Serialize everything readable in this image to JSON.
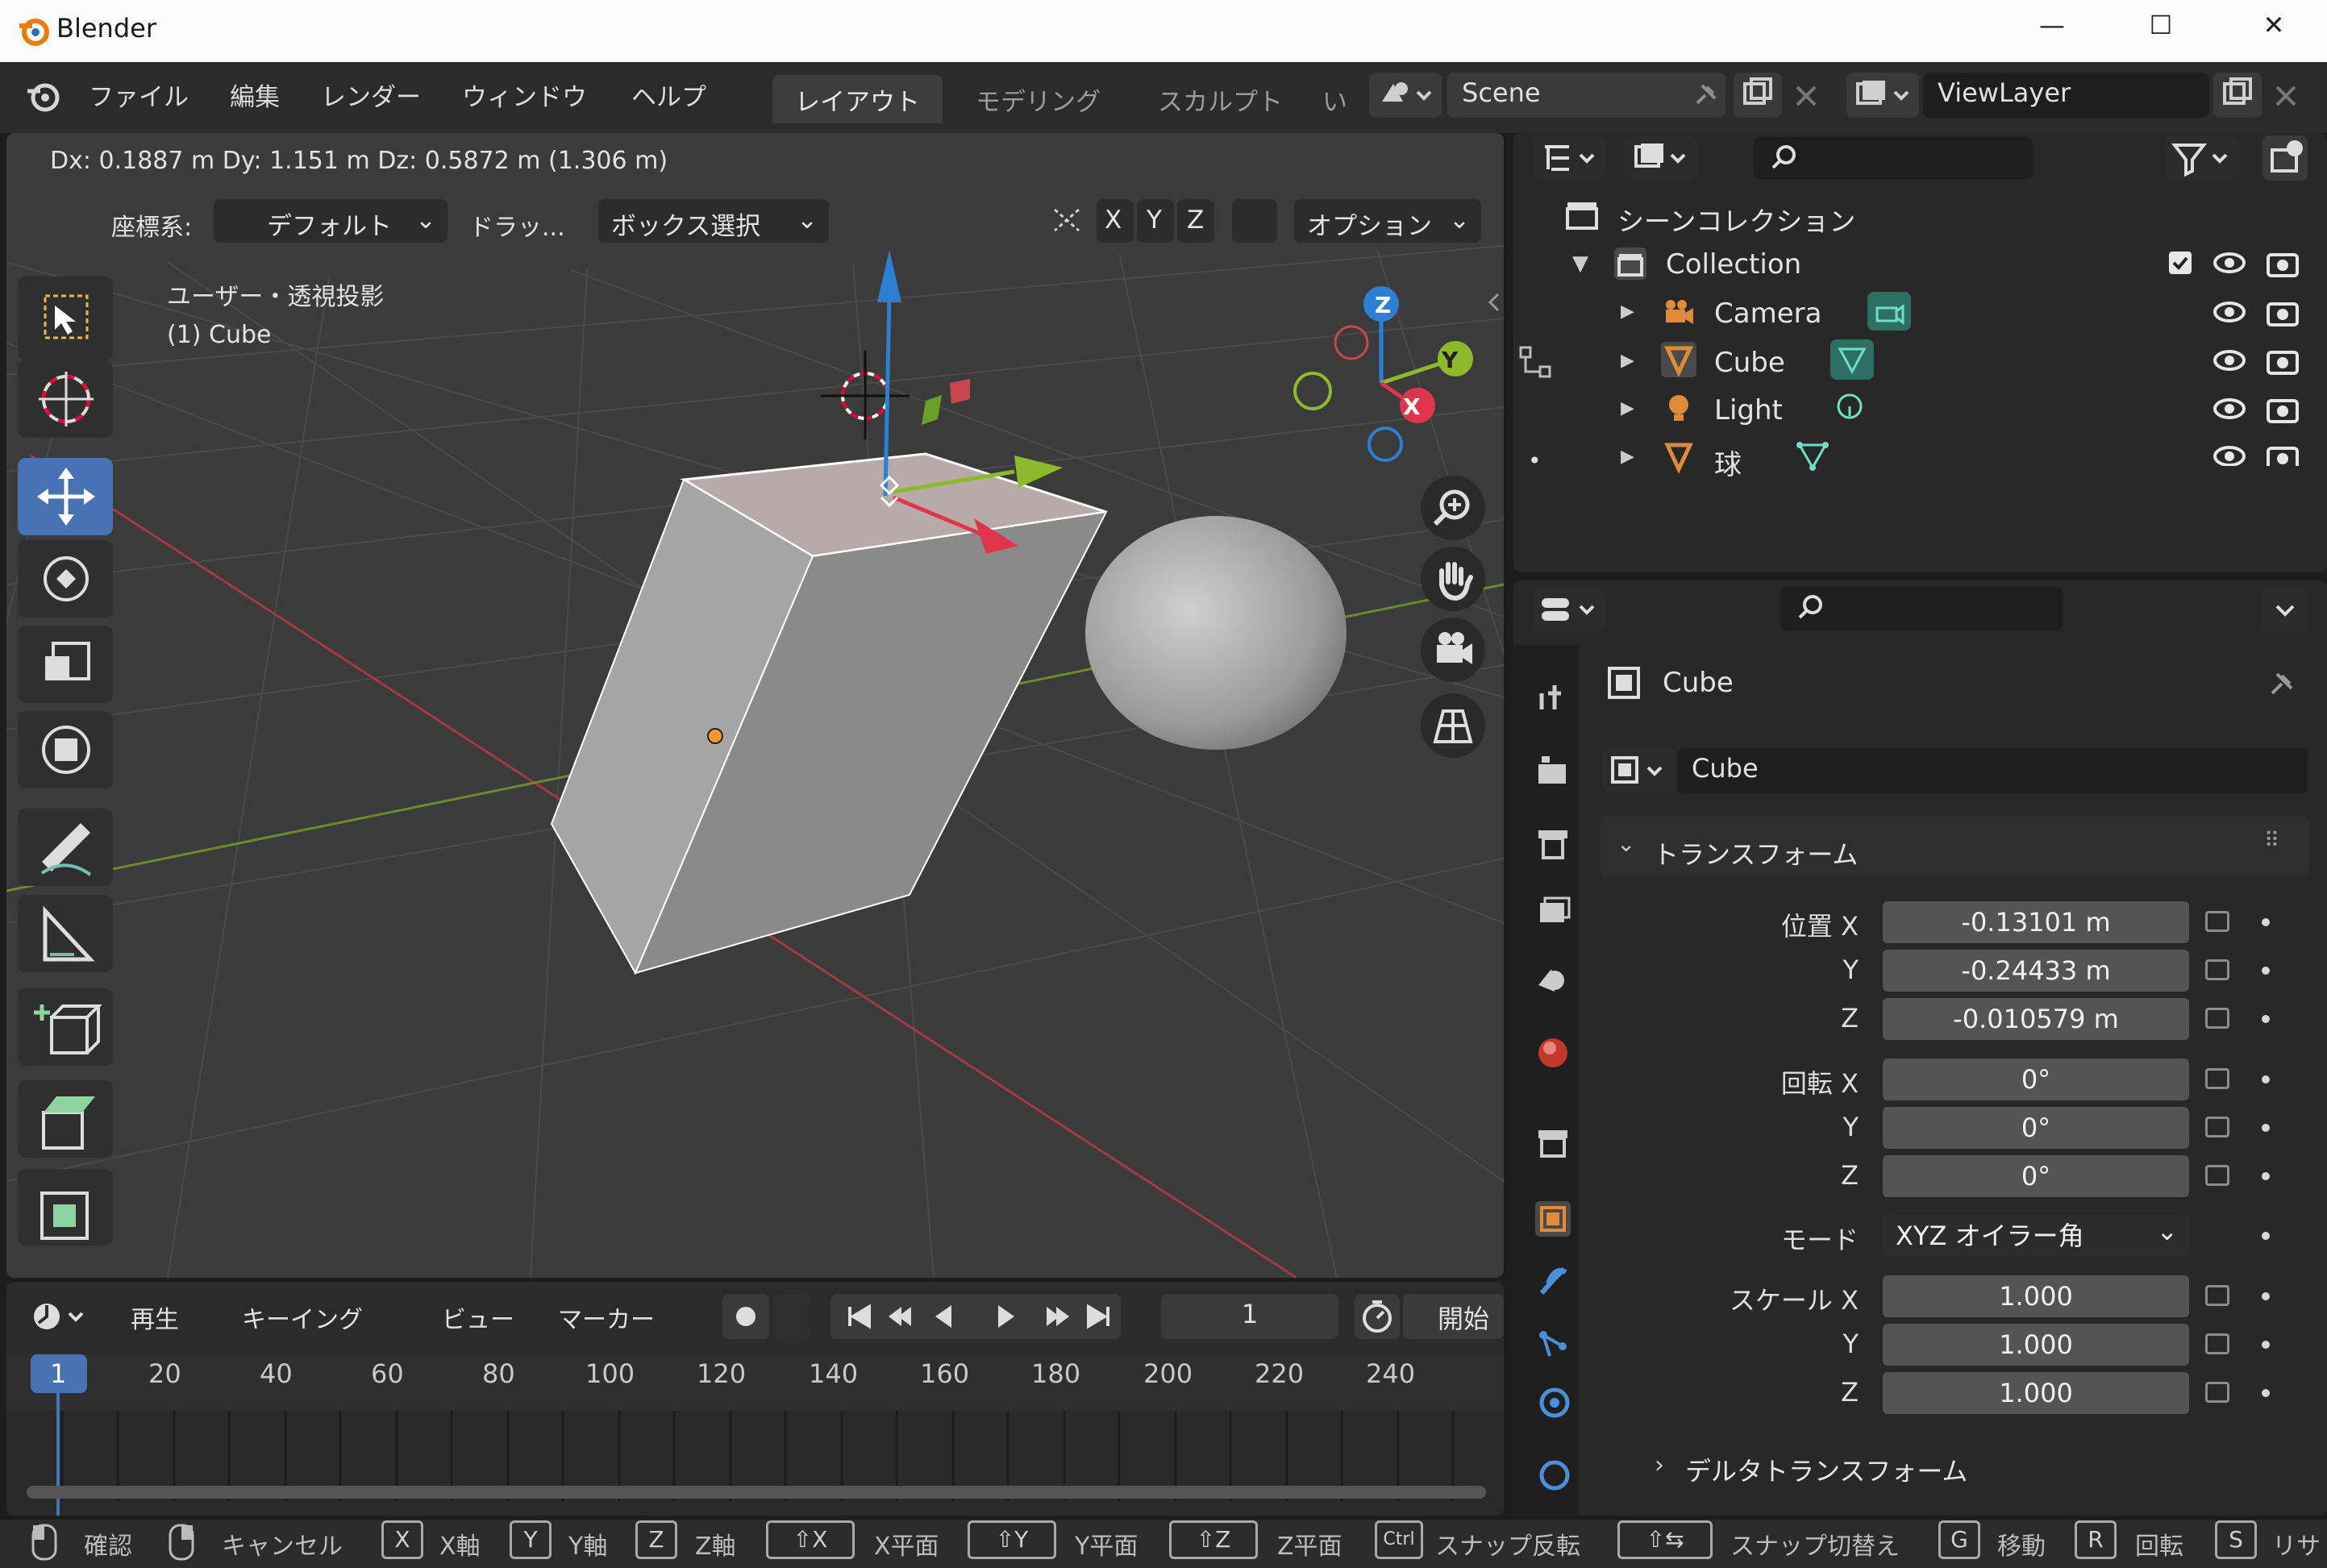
{
  "window": {
    "title": "Blender",
    "minimize": "—",
    "maximize": "☐",
    "close": "✕"
  },
  "menu": [
    "ファイル",
    "編集",
    "レンダー",
    "ウィンドウ",
    "ヘルプ"
  ],
  "workspace_tabs": [
    "レイアウト",
    "モデリング",
    "スカルプト",
    "い"
  ],
  "scene": {
    "name": "Scene"
  },
  "view_layer": {
    "name": "ViewLayer"
  },
  "viewport": {
    "delta_readout": "Dx: 0.1887 m   Dy: 1.151 m   Dz: 0.5872 m (1.306 m)",
    "coord_label": "座標系:",
    "coord_value": "デフォルト",
    "drag_label": "ドラッ...",
    "select_mode": "ボックス選択",
    "axis_x": "X",
    "axis_y": "Y",
    "axis_z": "Z",
    "options": "オプション",
    "view_name": "ユーザー・透視投影",
    "object_name": "(1) Cube",
    "gizmo_x": "X",
    "gizmo_y": "Y",
    "gizmo_z": "Z"
  },
  "timeline": {
    "menu": [
      "再生",
      "キーイング",
      "ビュー",
      "マーカー"
    ],
    "current_frame": "1",
    "start_label": "開始",
    "frame_markers": [
      "1",
      "20",
      "40",
      "60",
      "80",
      "100",
      "120",
      "140",
      "160",
      "180",
      "200",
      "220",
      "240"
    ]
  },
  "outliner": {
    "scene_collection": "シーンコレクション",
    "collection": "Collection",
    "items": [
      {
        "name": "Camera",
        "icon": "camera-icon",
        "color": "#e08b3a"
      },
      {
        "name": "Cube",
        "icon": "mesh-icon",
        "color": "#e08b3a"
      },
      {
        "name": "Light",
        "icon": "light-icon",
        "color": "#e08b3a"
      },
      {
        "name": "球",
        "icon": "mesh-icon",
        "color": "#e08b3a"
      }
    ]
  },
  "properties": {
    "object_title": "Cube",
    "object_name_field": "Cube",
    "transform_header": "トランスフォーム",
    "location_label": "位置 X",
    "location": [
      "-0.13101 m",
      "-0.24433 m",
      "-0.010579 m"
    ],
    "rotation_label": "回転 X",
    "rotation": [
      "0°",
      "0°",
      "0°"
    ],
    "mode_label": "モード",
    "mode_value": "XYZ オイラー角",
    "scale_label": "スケール X",
    "scale": [
      "1.000",
      "1.000",
      "1.000"
    ],
    "axis_y": "Y",
    "axis_z": "Z",
    "delta_transform": "デルタトランスフォーム"
  },
  "statusbar": [
    {
      "key": "",
      "label": "確認"
    },
    {
      "key": "",
      "label": "キャンセル"
    },
    {
      "key": "X",
      "label": "X軸"
    },
    {
      "key": "Y",
      "label": "Y軸"
    },
    {
      "key": "Z",
      "label": "Z軸"
    },
    {
      "key": "⇧X",
      "label": "X平面"
    },
    {
      "key": "⇧Y",
      "label": "Y平面"
    },
    {
      "key": "⇧Z",
      "label": "Z平面"
    },
    {
      "key": "Ctrl",
      "label": "スナップ反転"
    },
    {
      "key": "⇧⇆",
      "label": "スナップ切替え"
    },
    {
      "key": "G",
      "label": "移動"
    },
    {
      "key": "R",
      "label": "回転"
    },
    {
      "key": "S",
      "label": "リサ"
    }
  ],
  "colors": {
    "accent": "#4772b3",
    "x_axis": "#e0354d",
    "y_axis": "#8cba2c",
    "z_axis": "#2d7fd6",
    "object": "#e08b3a"
  }
}
